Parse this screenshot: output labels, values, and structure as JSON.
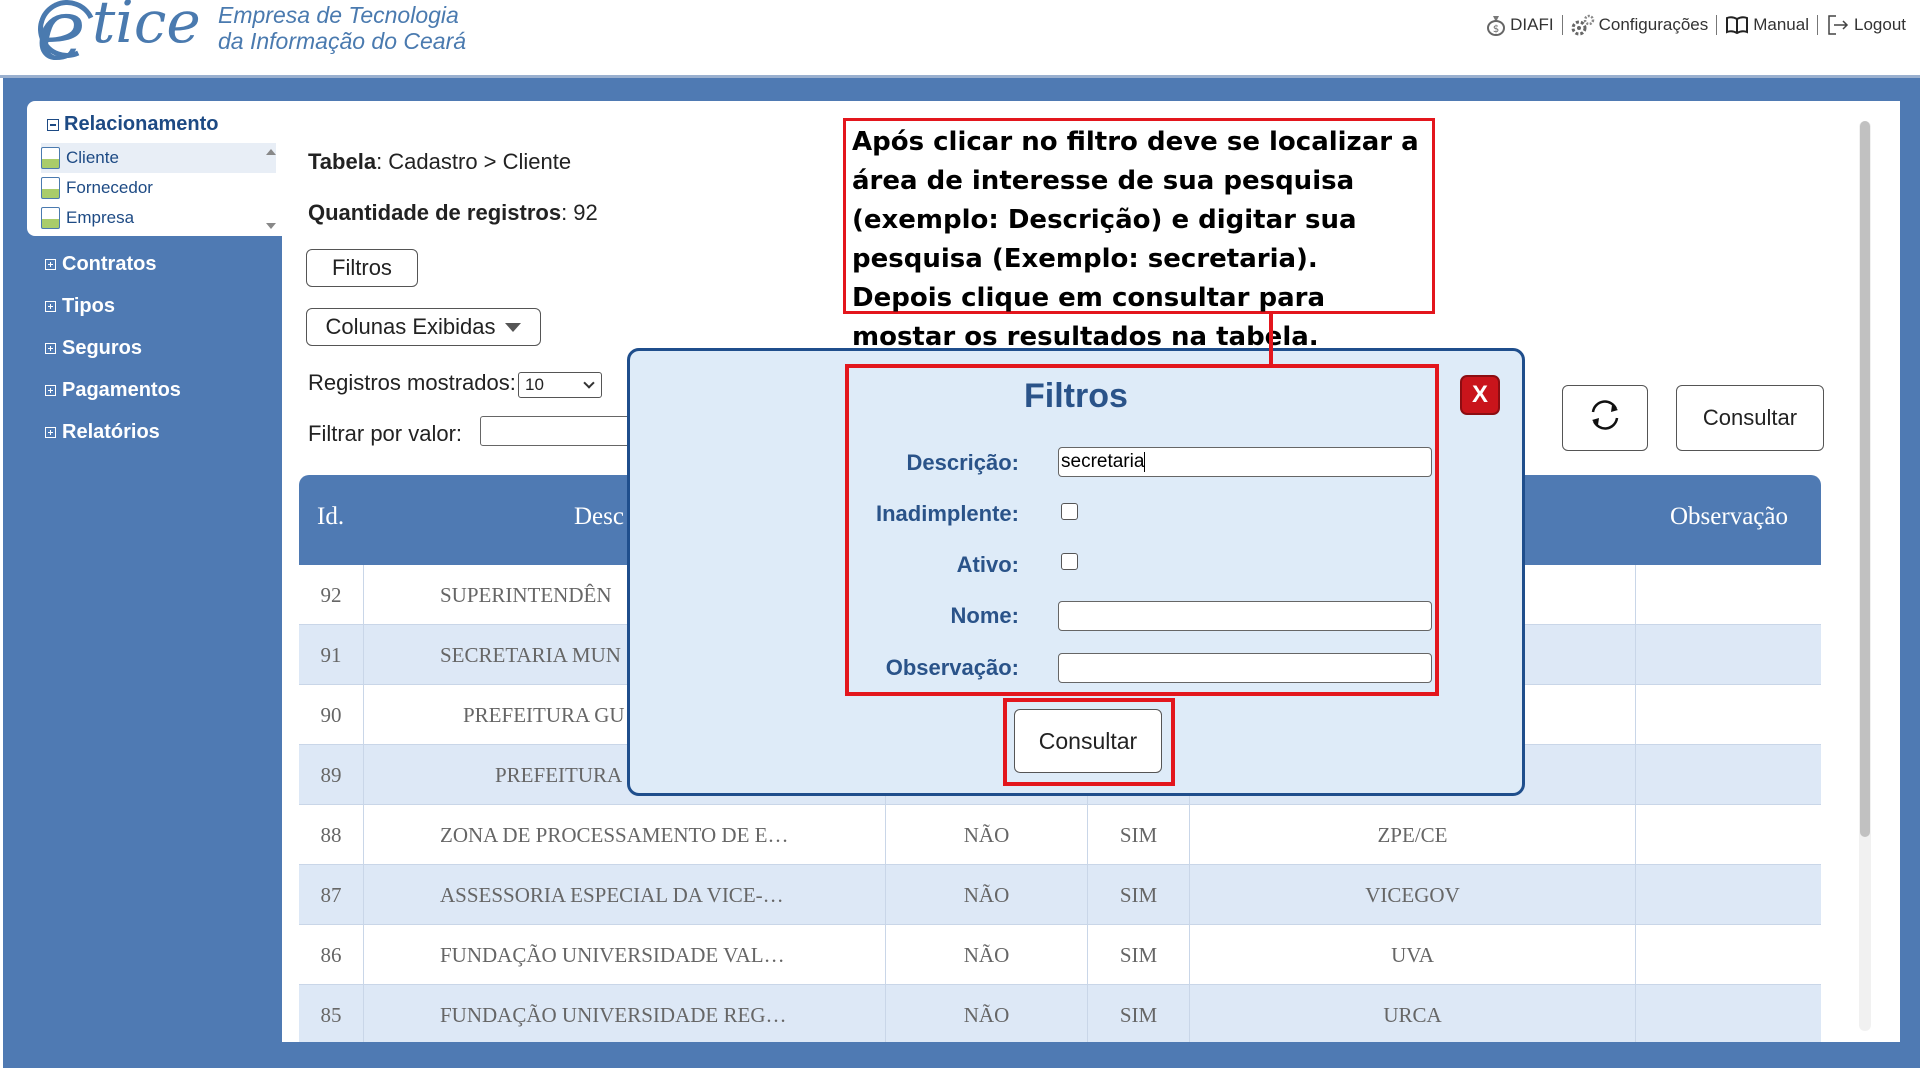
{
  "header": {
    "logo_text": "tice",
    "company_line1": "Empresa de Tecnologia",
    "company_line2": "da Informação do Ceará",
    "nav": [
      {
        "label": "DIAFI",
        "icon": "money-bag-icon"
      },
      {
        "label": "Configurações",
        "icon": "gears-icon"
      },
      {
        "label": "Manual",
        "icon": "book-icon"
      },
      {
        "label": "Logout",
        "icon": "logout-icon"
      }
    ]
  },
  "sidebar": {
    "relacionamento_title": "Relacionamento",
    "relacionamento_items": [
      "Cliente",
      "Fornecedor",
      "Empresa"
    ],
    "groups": [
      "Contratos",
      "Tipos",
      "Seguros",
      "Pagamentos",
      "Relatórios"
    ]
  },
  "content": {
    "tabela_label": "Tabela",
    "tabela_value": ": Cadastro > Cliente",
    "qtd_label": "Quantidade de registros",
    "qtd_value": ": 92",
    "filtros_button": "Filtros",
    "colunas_button": "Colunas Exibidas",
    "registros_label": "Registros mostrados:",
    "registros_value": "10",
    "filtrar_label": "Filtrar por valor:",
    "consultar_button": "Consultar"
  },
  "table": {
    "headers": {
      "id": "Id.",
      "descricao": "Desc",
      "observacao": "Observação"
    },
    "rows": [
      {
        "id": "92",
        "descricao": "SUPERINTENDÊN",
        "inad": "",
        "ativo": "",
        "nome": "",
        "obs": ""
      },
      {
        "id": "91",
        "descricao": "SECRETARIA MUN",
        "inad": "",
        "ativo": "",
        "nome": "",
        "obs": ""
      },
      {
        "id": "90",
        "descricao": "PREFEITURA GU",
        "inad": "",
        "ativo": "",
        "nome": "",
        "obs": ""
      },
      {
        "id": "89",
        "descricao": "PREFEITURA",
        "inad": "",
        "ativo": "",
        "nome": "",
        "obs": ""
      },
      {
        "id": "88",
        "descricao": "ZONA DE PROCESSAMENTO DE E…",
        "inad": "NÃO",
        "ativo": "SIM",
        "nome": "ZPE/CE",
        "obs": ""
      },
      {
        "id": "87",
        "descricao": "ASSESSORIA ESPECIAL DA VICE-…",
        "inad": "NÃO",
        "ativo": "SIM",
        "nome": "VICEGOV",
        "obs": ""
      },
      {
        "id": "86",
        "descricao": "FUNDAÇÃO UNIVERSIDADE VAL…",
        "inad": "NÃO",
        "ativo": "SIM",
        "nome": "UVA",
        "obs": ""
      },
      {
        "id": "85",
        "descricao": "FUNDAÇÃO UNIVERSIDADE REG…",
        "inad": "NÃO",
        "ativo": "SIM",
        "nome": "URCA",
        "obs": ""
      }
    ]
  },
  "modal": {
    "title": "Filtros",
    "close_label": "X",
    "labels": {
      "descricao": "Descrição:",
      "inadimplente": "Inadimplente:",
      "ativo": "Ativo:",
      "nome": "Nome:",
      "observacao": "Observação:"
    },
    "descricao_value": "secretaria",
    "consultar_button": "Consultar"
  },
  "annotation": {
    "callout_text": "Após clicar no filtro deve se localizar a área de interesse de sua pesquisa (exemplo: Descrição) e digitar sua pesquisa (Exemplo: secretaria). Depois clique em consultar para mostar os resultados na tabela.",
    "highlight_color": "#e3161d"
  },
  "colors": {
    "frame_blue": "#4f7ab3",
    "row_alt": "#dde8f6",
    "modal_bg": "#deebf8",
    "title_blue": "#2a5389",
    "close_red": "#c9141b"
  }
}
